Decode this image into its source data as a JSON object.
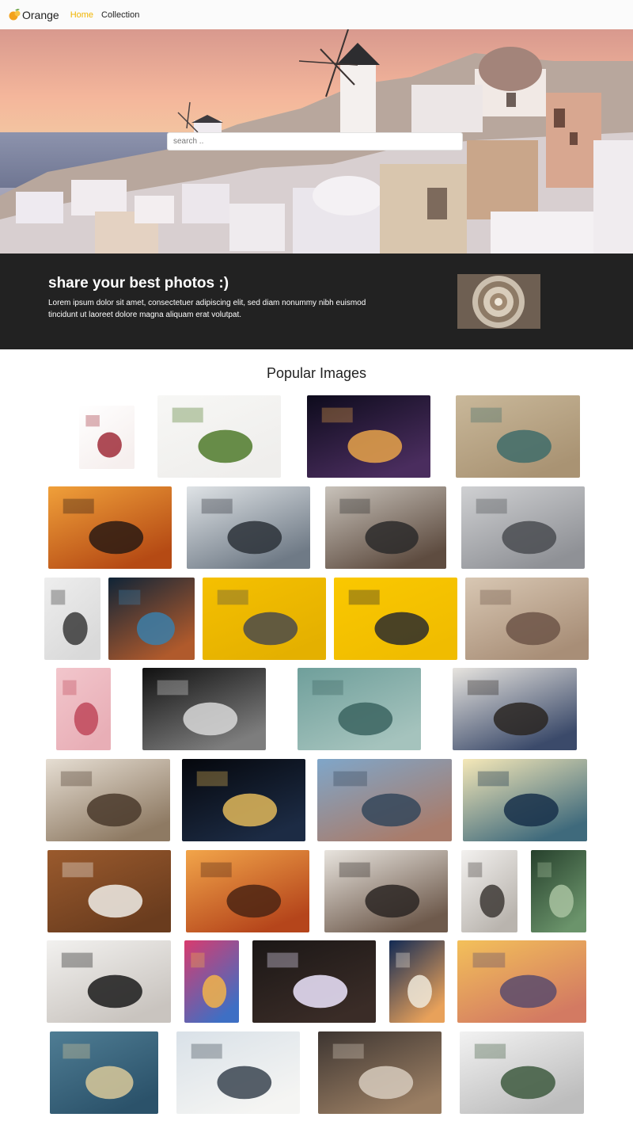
{
  "nav": {
    "brand": "Orange",
    "links": [
      {
        "label": "Home",
        "active": true
      },
      {
        "label": "Collection",
        "active": false
      }
    ]
  },
  "hero": {
    "search_placeholder": "search .."
  },
  "banner": {
    "title": "share your best photos :)",
    "text": "Lorem ipsum dolor sit amet, consectetuer adipiscing elit, sed diam nonummy nibh euismod tincidunt ut laoreet dolore magna aliquam erat volutpat."
  },
  "gallery": {
    "title": "Popular Images",
    "images": [
      {
        "name": "flower-bouquet-image",
        "colors": [
          "#ffffff",
          "#f6efee",
          "#a02d3a"
        ]
      },
      {
        "name": "cactus-image",
        "colors": [
          "#f7f7f5",
          "#efeeec",
          "#4f7a2a"
        ]
      },
      {
        "name": "milky-way-image",
        "colors": [
          "#0d0b1c",
          "#4a2d5e",
          "#e7a34a"
        ]
      },
      {
        "name": "typewriter-desk-image",
        "colors": [
          "#c9b89a",
          "#a99373",
          "#3f6c6a"
        ]
      },
      {
        "name": "heart-hands-sunset-image",
        "colors": [
          "#f0a03a",
          "#b54a14",
          "#2a1a13"
        ]
      },
      {
        "name": "laptop-meeting-image",
        "colors": [
          "#dfe3e6",
          "#6f7a86",
          "#2d3239"
        ]
      },
      {
        "name": "team-fist-bump-image",
        "colors": [
          "#c8c2ba",
          "#5e4c40",
          "#2b2a2a"
        ]
      },
      {
        "name": "passion-led-us-here-image",
        "colors": [
          "#cfd0d2",
          "#8f9196",
          "#4a4c51"
        ]
      },
      {
        "name": "white-typewriter-image",
        "colors": [
          "#eeeeee",
          "#d9d9d9",
          "#3a3a3a"
        ]
      },
      {
        "name": "nebula-bubble-image",
        "colors": [
          "#0f2437",
          "#b05a2c",
          "#3b7ea8"
        ]
      },
      {
        "name": "pencils-yellow-image",
        "colors": [
          "#f5c000",
          "#e4b000",
          "#4a4a4a"
        ]
      },
      {
        "name": "yellow-wall-walker-image",
        "colors": [
          "#fac800",
          "#f0bc00",
          "#2b2b2b"
        ]
      },
      {
        "name": "book-pages-wall-image",
        "colors": [
          "#d8c7b3",
          "#a88e77",
          "#6d5548"
        ]
      },
      {
        "name": "pink-paper-lips-image",
        "colors": [
          "#f2c6cc",
          "#e8aeb6",
          "#c0485a"
        ]
      },
      {
        "name": "architecture-curves-image",
        "colors": [
          "#111111",
          "#7d7d7d",
          "#d8d8d8"
        ]
      },
      {
        "name": "succulent-image",
        "colors": [
          "#6f9f9b",
          "#a5c3bd",
          "#3b6460"
        ]
      },
      {
        "name": "business-newspaper-image",
        "colors": [
          "#e7e4df",
          "#3b4a6a",
          "#2a2622"
        ]
      },
      {
        "name": "conference-room-image",
        "colors": [
          "#e6ded3",
          "#8e7a63",
          "#4a3a2c"
        ]
      },
      {
        "name": "earth-night-image",
        "colors": [
          "#05070c",
          "#1c2b44",
          "#e2b85a"
        ]
      },
      {
        "name": "city-skyline-image",
        "colors": [
          "#7fa6c9",
          "#a97c6b",
          "#34465a"
        ]
      },
      {
        "name": "canyon-river-image",
        "colors": [
          "#f5e8b8",
          "#3f6a7c",
          "#18304a"
        ]
      },
      {
        "name": "desk-coffee-image",
        "colors": [
          "#9a5a2d",
          "#6a3c1e",
          "#f0ede8"
        ]
      },
      {
        "name": "mountain-sunrise-image",
        "colors": [
          "#f2a54a",
          "#b5451b",
          "#4c2513"
        ]
      },
      {
        "name": "friends-laughing-image",
        "colors": [
          "#e8e4de",
          "#6e5a4c",
          "#2c2623"
        ]
      },
      {
        "name": "office-window-image",
        "colors": [
          "#f3f1ef",
          "#b9b4ae",
          "#3e3a36"
        ]
      },
      {
        "name": "green-succulents-image",
        "colors": [
          "#26402c",
          "#6b946b",
          "#a8c2a0"
        ]
      },
      {
        "name": "imac-desk-image",
        "colors": [
          "#f2f1ef",
          "#c9c4bf",
          "#1b1b1b"
        ]
      },
      {
        "name": "neon-corridor-image",
        "colors": [
          "#d93b6e",
          "#3e6fc4",
          "#f2b34a"
        ]
      },
      {
        "name": "neon-sign-image",
        "colors": [
          "#1b1716",
          "#3a2c27",
          "#efe6ff"
        ]
      },
      {
        "name": "lighthouse-image",
        "colors": [
          "#122a54",
          "#e8a15a",
          "#f0e9d9"
        ]
      },
      {
        "name": "sunset-mountains-image",
        "colors": [
          "#f3c05a",
          "#d37a62",
          "#5a4b6c"
        ]
      },
      {
        "name": "swimmer-sparkler-image",
        "colors": [
          "#4f7d94",
          "#2b526a",
          "#d9c99a"
        ]
      },
      {
        "name": "writing-paper-image",
        "colors": [
          "#d9e1e8",
          "#f5f5f3",
          "#3a4450"
        ]
      },
      {
        "name": "handshake-desk-image",
        "colors": [
          "#3d3531",
          "#9a7e63",
          "#d7cbbd"
        ]
      },
      {
        "name": "laptop-plant-table-image",
        "colors": [
          "#f2f2f2",
          "#bdbdbd",
          "#3e5b40"
        ]
      }
    ]
  }
}
